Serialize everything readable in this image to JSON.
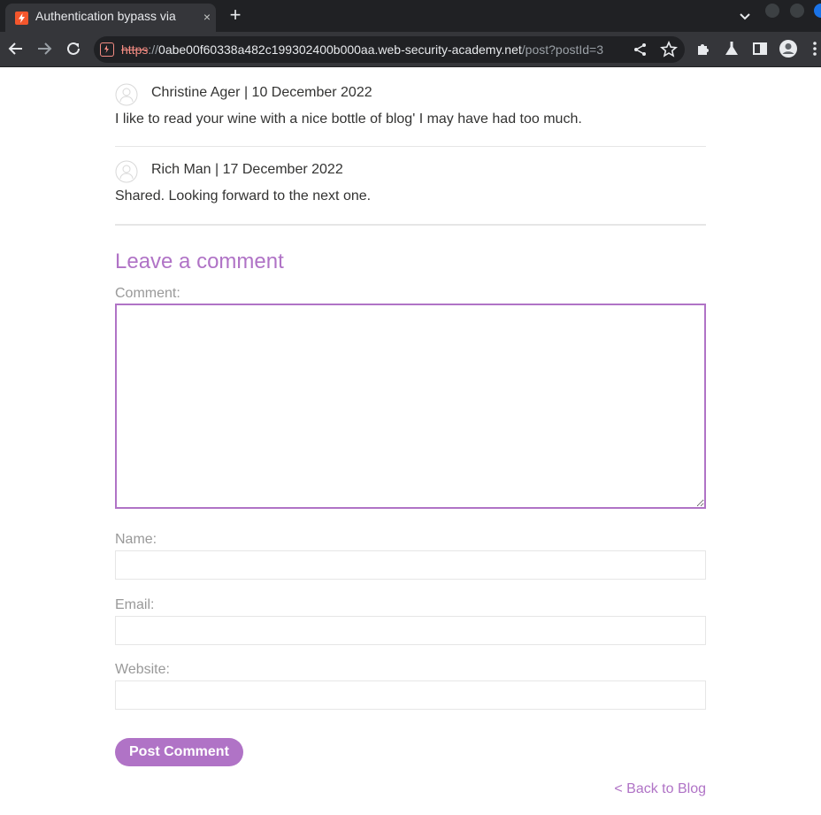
{
  "browser": {
    "tab_title": "Authentication bypass via",
    "tab_close": "×",
    "new_tab": "+",
    "url_scheme": "https",
    "url_sep": "://",
    "url_host": "0abe00f60338a482c199302400b000aa.web-security-academy.net",
    "url_path": "/post?postId=3"
  },
  "comments": [
    {
      "author": "Christine Ager | 10 December 2022",
      "text": "I like to read your wine with a nice bottle of blog' I may have had too much."
    },
    {
      "author": "Rich Man | 17 December 2022",
      "text": "Shared. Looking forward to the next one."
    }
  ],
  "form": {
    "heading": "Leave a comment",
    "comment_label": "Comment:",
    "name_label": "Name:",
    "email_label": "Email:",
    "website_label": "Website:",
    "comment_value": "",
    "name_value": "",
    "email_value": "",
    "website_value": "",
    "submit_label": "Post Comment"
  },
  "back_link": "< Back to Blog",
  "colors": {
    "accent": "#b073c6",
    "label": "#999999",
    "text": "#333332",
    "chrome_bg": "#202124",
    "toolbar_bg": "#35363a"
  },
  "icons": {
    "favicon": "burp-lightning-icon",
    "back": "arrow-left-icon",
    "forward": "arrow-right-icon",
    "reload": "reload-icon",
    "site_warning": "not-secure-icon",
    "share": "share-icon",
    "bookmark": "star-icon",
    "extensions": "puzzle-icon",
    "labs": "flask-icon",
    "sidepanel": "side-panel-icon",
    "profile": "account-icon",
    "menu": "kebab-menu-icon",
    "avatar": "user-avatar-icon"
  }
}
